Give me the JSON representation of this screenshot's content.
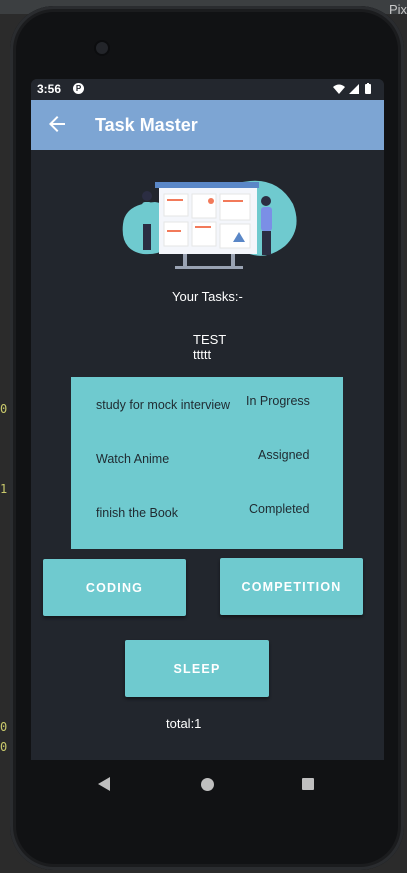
{
  "ide": {
    "right_label": "Pix",
    "left_marks": [
      "0",
      "1",
      "0",
      "0"
    ]
  },
  "status_bar": {
    "time": "3:56",
    "app_icon": "P",
    "icons": [
      "wifi-icon",
      "signal-icon",
      "battery-icon"
    ]
  },
  "app_bar": {
    "title": "Task Master",
    "back_icon": "arrow-back-icon"
  },
  "main": {
    "your_tasks_label": "Your Tasks:-",
    "test_line": "TEST",
    "ttttt_line": "ttttt",
    "tasks": [
      {
        "title": "study for mock interview",
        "status": "In Progress"
      },
      {
        "title": "Watch Anime",
        "status": "Assigned"
      },
      {
        "title": "finish the Book",
        "status": "Completed"
      }
    ],
    "buttons": {
      "coding": "CODING",
      "competition": "COMPETITION",
      "sleep": "SLEEP"
    },
    "total_label": "total:1"
  },
  "colors": {
    "app_bar": "#7da5d3",
    "screen_bg": "#22262d",
    "accent": "#6fcacf"
  }
}
